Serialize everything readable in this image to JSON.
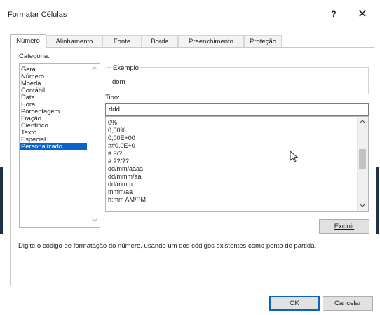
{
  "window": {
    "title": "Formatar Células",
    "help_label": "?",
    "close_label": "✕"
  },
  "tabs": [
    {
      "label": "Número",
      "active": true
    },
    {
      "label": "Alinhamento",
      "active": false
    },
    {
      "label": "Fonte",
      "active": false
    },
    {
      "label": "Borda",
      "active": false
    },
    {
      "label": "Preenchimento",
      "active": false
    },
    {
      "label": "Proteção",
      "active": false
    }
  ],
  "categoria": {
    "label": "Categoria:",
    "items": [
      "Geral",
      "Número",
      "Moeda",
      "Contábil",
      "Data",
      "Hora",
      "Porcentagem",
      "Fração",
      "Científico",
      "Texto",
      "Especial",
      "Personalizado"
    ],
    "selected": "Personalizado"
  },
  "exemplo": {
    "label": "Exemplo",
    "value": "dom"
  },
  "tipo": {
    "label": "Tipo:",
    "value": "ddd",
    "formats": [
      "0%",
      "0,00%",
      "0,00E+00",
      "##0,0E+0",
      "# ?/?",
      "# ??/??",
      "dd/mm/aaaa",
      "dd/mmm/aa",
      "dd/mmm",
      "mmm/aa",
      "h:mm AM/PM"
    ]
  },
  "buttons": {
    "excluir": "Excluir",
    "ok": "OK",
    "cancelar": "Cancelar"
  },
  "hint": "Digite o código de formatação do número, usando um dos códigos existentes como ponto de partida.",
  "colors": {
    "selection": "#0a64c8",
    "accent_border": "#0a64c8"
  },
  "icons": {
    "scroll_up": "chevron-up-icon",
    "scroll_down": "chevron-down-icon",
    "cursor": "mouse-pointer-icon"
  }
}
